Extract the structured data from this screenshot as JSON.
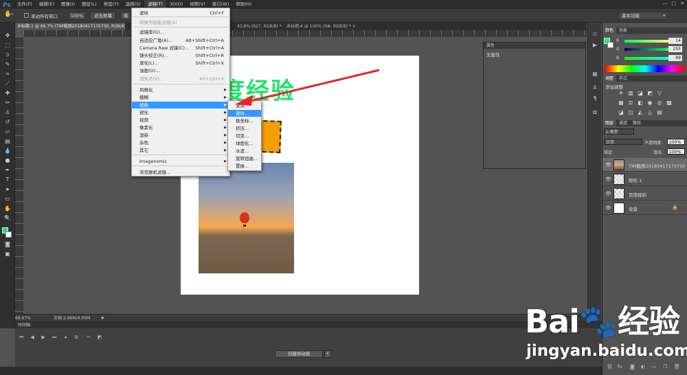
{
  "menubar": {
    "logo": "Ps",
    "items": [
      "文件(F)",
      "编辑(E)",
      "图像(I)",
      "图层(L)",
      "类型(Y)",
      "选择(S)",
      "滤镜(T)",
      "3D(D)",
      "视图(V)",
      "窗口(W)",
      "帮助(H)"
    ],
    "window_controls": [
      "—",
      "□",
      "✕"
    ]
  },
  "options": {
    "scroll_all": "滚动所有窗口",
    "zoom_100": "100%",
    "fit_screen": "适合屏幕",
    "fill_screen": "填",
    "workspace": "基本功能"
  },
  "tabs": [
    "未标题-1 @ 66.7% (TIM截图20180417170730, RGB/8) * ×",
    "",
    "43.8% (627, RGB/8) * ×",
    "未标题-4 @ 100% (0#, RGB/8) * ×"
  ],
  "artwork": {
    "headline_text": "度经验"
  },
  "filter_menu": {
    "items": [
      {
        "label": "波纹",
        "shortcut": "Ctrl+F",
        "disabled": false,
        "submenu": false
      },
      {
        "label": "转换为智能滤镜(S)",
        "shortcut": "",
        "disabled": true,
        "submenu": false
      },
      {
        "label": "滤镜库(G)...",
        "shortcut": "",
        "disabled": false,
        "submenu": false
      },
      {
        "label": "自适应广角(A)...",
        "shortcut": "Alt+Shift+Ctrl+A",
        "disabled": false,
        "submenu": false
      },
      {
        "label": "Camera Raw 滤镜(C)...",
        "shortcut": "Shift+Ctrl+A",
        "disabled": false,
        "submenu": false
      },
      {
        "label": "镜头校正(R)...",
        "shortcut": "Shift+Ctrl+R",
        "disabled": false,
        "submenu": false
      },
      {
        "label": "液化(L)...",
        "shortcut": "Shift+Ctrl+X",
        "disabled": false,
        "submenu": false
      },
      {
        "label": "油画(O)...",
        "shortcut": "",
        "disabled": false,
        "submenu": false
      },
      {
        "label": "消失点(V)...",
        "shortcut": "Alt+Ctrl+V",
        "disabled": true,
        "submenu": false
      },
      {
        "label": "风格化",
        "shortcut": "",
        "disabled": false,
        "submenu": true
      },
      {
        "label": "模糊",
        "shortcut": "",
        "disabled": false,
        "submenu": true
      },
      {
        "label": "扭曲",
        "shortcut": "",
        "disabled": false,
        "submenu": true
      },
      {
        "label": "锐化",
        "shortcut": "",
        "disabled": false,
        "submenu": true
      },
      {
        "label": "视频",
        "shortcut": "",
        "disabled": false,
        "submenu": true
      },
      {
        "label": "像素化",
        "shortcut": "",
        "disabled": false,
        "submenu": true
      },
      {
        "label": "渲染",
        "shortcut": "",
        "disabled": false,
        "submenu": true
      },
      {
        "label": "杂色",
        "shortcut": "",
        "disabled": false,
        "submenu": true
      },
      {
        "label": "其它",
        "shortcut": "",
        "disabled": false,
        "submenu": true
      },
      {
        "label": "Imagenomic",
        "shortcut": "",
        "disabled": false,
        "submenu": true
      },
      {
        "label": "浏览联机滤镜...",
        "shortcut": "",
        "disabled": false,
        "submenu": false
      }
    ],
    "highlighted": "扭曲"
  },
  "distort_submenu": {
    "items": [
      "波浪...",
      "波纹...",
      "极坐标...",
      "挤压...",
      "切变...",
      "球面化...",
      "水波...",
      "旋转扭曲...",
      "置换..."
    ],
    "highlighted": "波纹..."
  },
  "properties": {
    "title": "属性",
    "body": "无属性"
  },
  "color_panel": {
    "tabs": [
      "颜色",
      "色板"
    ],
    "channels": [
      {
        "label": "R",
        "value": "14"
      },
      {
        "label": "G",
        "value": "255"
      },
      {
        "label": "B",
        "value": "99"
      }
    ],
    "fg_color": "#0eff63"
  },
  "adjust_panel": {
    "tabs": [
      "调整",
      "样式"
    ],
    "add_label": "添加调整"
  },
  "layers_panel": {
    "tabs": [
      "图层",
      "通道",
      "路径"
    ],
    "kind": "ρ 类型",
    "blend": "正常",
    "opacity_label": "不透明度:",
    "opacity": "100%",
    "lock_label": "锁定:",
    "fill_label": "填充:",
    "fill": "100%",
    "layers": [
      {
        "name": "TIM截图20180417170730",
        "selected": true,
        "locked": false
      },
      {
        "name": "矩形 1",
        "selected": false,
        "locked": false
      },
      {
        "name": "百度经验",
        "selected": false,
        "locked": false
      },
      {
        "name": "背景",
        "selected": false,
        "locked": true
      }
    ]
  },
  "status": {
    "zoom": "66.67%",
    "doc": "文档:2.86M/4.05M"
  },
  "timeline": {
    "title": "时间轴",
    "create_button": "创建帧动画"
  },
  "watermark": {
    "brand": "Bai🐾经验",
    "url": "jingyan.baidu.com"
  }
}
